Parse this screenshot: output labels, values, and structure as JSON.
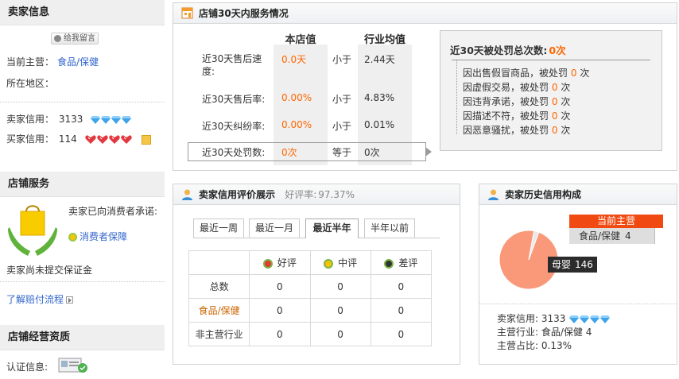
{
  "seller": {
    "title": "卖家信息",
    "message_button": "给我留言",
    "main_business_label": "当前主营：",
    "main_business_value": "食品/保健",
    "region_label": "所在地区：",
    "seller_credit_label": "卖家信用：",
    "seller_credit_value": "3133",
    "buyer_credit_label": "买家信用：",
    "buyer_credit_value": "114"
  },
  "store_service": {
    "title": "店铺服务",
    "promise_text": "卖家已向消费者承诺:",
    "protection_link": "消费者保障",
    "deposit_text": "卖家尚未提交保证金",
    "claim_link": "了解赔付流程"
  },
  "qualification": {
    "title": "店铺经营资质",
    "cert_label": "认证信息:"
  },
  "service30": {
    "title": "店铺30天内服务情况",
    "col_store": "本店值",
    "col_industry": "行业均值",
    "rows": [
      {
        "label": "近30天售后速度:",
        "value": "0.0天",
        "compare": "小于",
        "avg": "2.44天"
      },
      {
        "label": "近30天售后率:",
        "value": "0.00%",
        "compare": "小于",
        "avg": "4.83%"
      },
      {
        "label": "近30天纠纷率:",
        "value": "0.00%",
        "compare": "小于",
        "avg": "0.01%"
      },
      {
        "label": "近30天处罚数:",
        "value": "0次",
        "compare": "等于",
        "avg": "0次"
      }
    ],
    "penalty_title": "近30天被处罚总次数:",
    "penalty_total": "0次",
    "penalties": [
      {
        "text": "因出售假冒商品，被处罚",
        "count": "0",
        "unit": "次"
      },
      {
        "text": "因虚假交易，被处罚",
        "count": "0",
        "unit": "次"
      },
      {
        "text": "因违背承诺，被处罚",
        "count": "0",
        "unit": "次"
      },
      {
        "text": "因描述不符，被处罚",
        "count": "0",
        "unit": "次"
      },
      {
        "text": "因恶意骚扰，被处罚",
        "count": "0",
        "unit": "次"
      }
    ]
  },
  "rating": {
    "title": "卖家信用评价展示",
    "good_rate_label": "好评率:",
    "good_rate_value": "97.37%",
    "tabs": [
      "最近一周",
      "最近一月",
      "最近半年",
      "半年以前"
    ],
    "active_tab": "最近半年",
    "col_good": "好评",
    "col_neutral": "中评",
    "col_bad": "差评",
    "rows": [
      {
        "label": "总数",
        "good": "0",
        "neutral": "0",
        "bad": "0"
      },
      {
        "label": "食品/保健",
        "good": "0",
        "neutral": "0",
        "bad": "0"
      },
      {
        "label": "非主营行业",
        "good": "0",
        "neutral": "0",
        "bad": "0"
      }
    ]
  },
  "history": {
    "title": "卖家历史信用构成",
    "legend_title": "当前主营",
    "legend_item": "食品/保健",
    "legend_count": "4",
    "tooltip_name": "母婴",
    "tooltip_value": "146",
    "seller_credit_label": "卖家信用:",
    "seller_credit_value": "3133",
    "industry_label": "主营行业:",
    "industry_value": "食品/保健 4",
    "ratio_label": "主营占比:",
    "ratio_value": "0.13%"
  },
  "chart_data": {
    "type": "pie",
    "categories": [
      "母婴",
      "食品/保健"
    ],
    "values": [
      146,
      4
    ]
  },
  "colors": {
    "accent_orange": "#f60",
    "link_blue": "#36c",
    "pie_main": "#f9997a",
    "legend_red": "#f04a12",
    "gem_blue": "#3fa3e8",
    "heart_red": "#e2383f"
  }
}
